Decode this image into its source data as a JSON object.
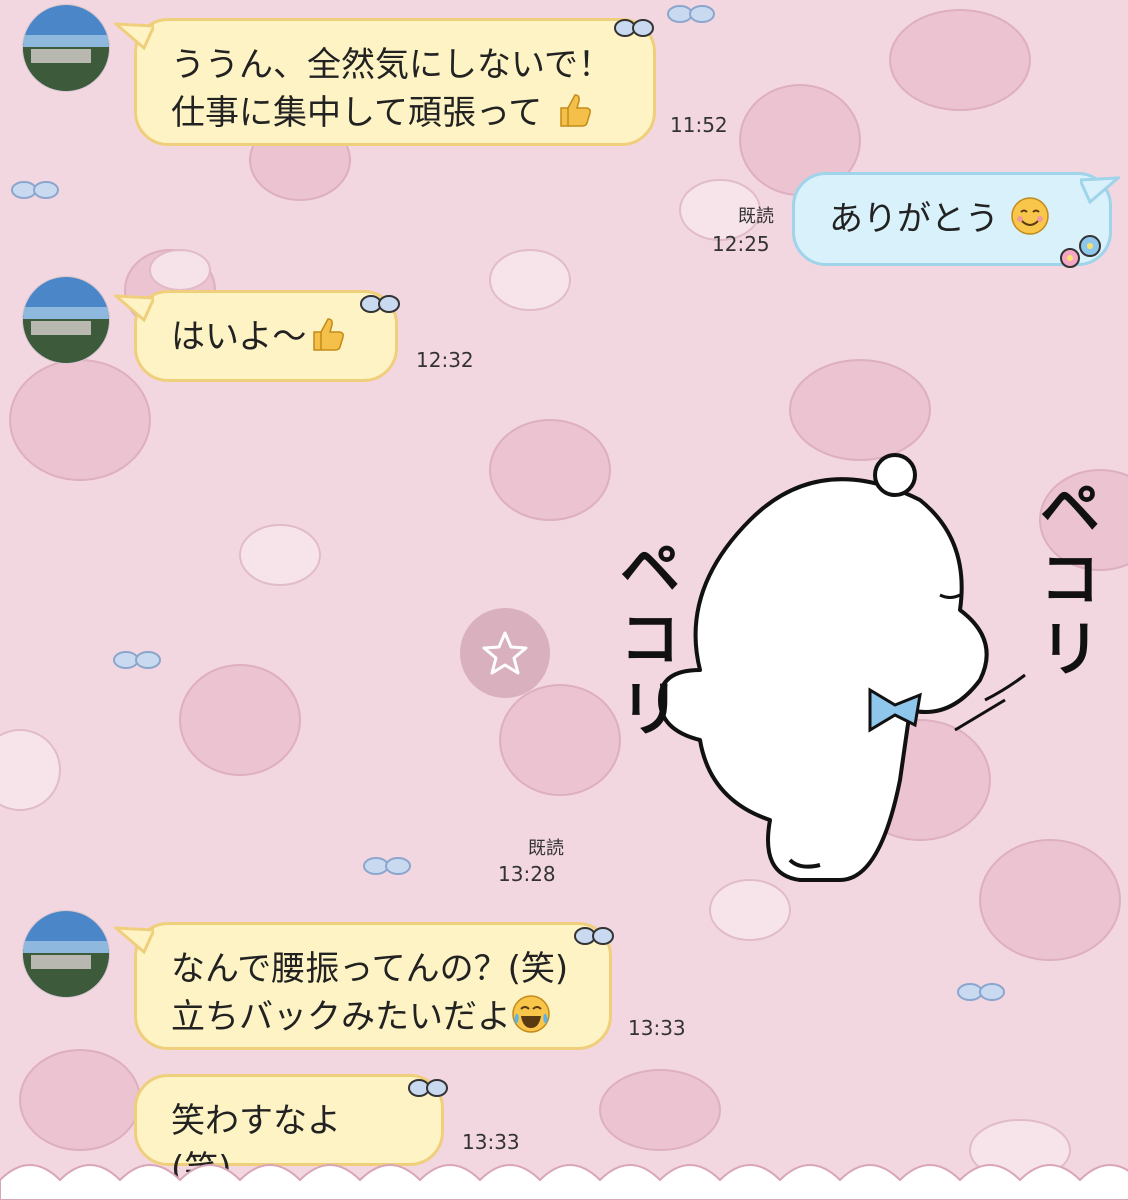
{
  "messages": [
    {
      "id": "m1",
      "side": "in",
      "lines": [
        "ううん、全然気にしないで！",
        "仕事に集中して頑張って"
      ],
      "emoji": "thumbs-up",
      "time": "11:52"
    },
    {
      "id": "m2",
      "side": "out",
      "lines": [
        "ありがとう"
      ],
      "emoji": "smiling-face",
      "read": "既読",
      "time": "12:25"
    },
    {
      "id": "m3",
      "side": "in",
      "lines": [
        "はいよ〜"
      ],
      "emoji": "thumbs-up",
      "time": "12:32"
    },
    {
      "id": "m4",
      "side": "out",
      "type": "sticker",
      "sticker_text": [
        "ペコリ",
        "ペコリ"
      ],
      "read": "既読",
      "time": "13:28"
    },
    {
      "id": "m5",
      "side": "in",
      "lines": [
        "なんで腰振ってんの？(笑)",
        "立ちバックみたいだよ"
      ],
      "emoji": "tears-of-joy",
      "time": "13:33"
    },
    {
      "id": "m6",
      "side": "in",
      "lines": [
        "笑わすなよ (笑)"
      ],
      "time": "13:33"
    }
  ],
  "icons": {
    "favorite": "star-icon",
    "avatar": "avatar-photo-city-view"
  },
  "colors": {
    "background": "#f2d6e0",
    "incoming_bubble": "#fdf3c4",
    "incoming_border": "#f0cf7c",
    "outgoing_bubble": "#d9f1fb",
    "outgoing_border": "#9fd4ea"
  }
}
